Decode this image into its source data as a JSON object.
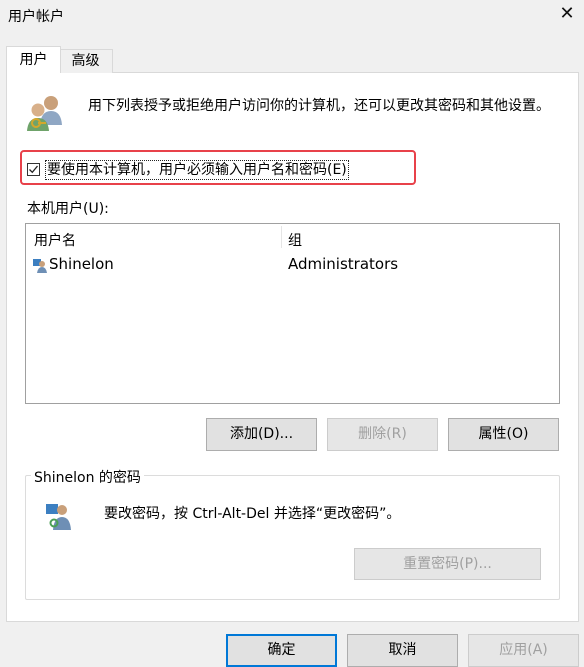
{
  "window": {
    "title": "用户帐户",
    "close_glyph": "✕"
  },
  "tabs": [
    {
      "label": "用户",
      "active": true
    },
    {
      "label": "高级",
      "active": false
    }
  ],
  "description": "用下列表授予或拒绝用户访问你的计算机，还可以更改其密码和其他设置。",
  "require_login_checkbox": {
    "label": "要使用本计算机，用户必须输入用户名和密码(E)",
    "checked": true
  },
  "local_users": {
    "label": "本机用户(U):",
    "columns": [
      "用户名",
      "组"
    ],
    "rows": [
      {
        "username": "Shinelon",
        "group": "Administrators"
      }
    ]
  },
  "user_buttons": {
    "add": "添加(D)...",
    "remove": "删除(R)",
    "properties": "属性(O)"
  },
  "password_group": {
    "title": "Shinelon 的密码",
    "text": "要改密码，按 Ctrl-Alt-Del 并选择“更改密码”。",
    "reset_button": "重置密码(P)..."
  },
  "dialog_buttons": {
    "ok": "确定",
    "cancel": "取消",
    "apply": "应用(A)"
  },
  "colors": {
    "highlight_border": "#e8414a",
    "default_button_border": "#0078d7"
  },
  "icons": {
    "users_icon": "users-icon",
    "user_row_icon": "user-icon",
    "password_icon": "user-key-icon"
  }
}
